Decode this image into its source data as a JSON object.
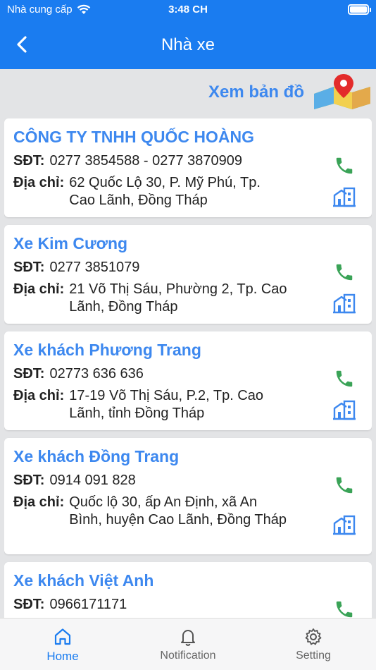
{
  "status_bar": {
    "carrier": "Nhà cung cấp",
    "time": "3:48 CH"
  },
  "header": {
    "title": "Nhà xe",
    "back_icon": "chevron-left-icon"
  },
  "map_link": {
    "label": "Xem bản đồ",
    "icon": "map-pin-icon"
  },
  "field_labels": {
    "phone": "SĐT:",
    "address": "Địa chỉ:"
  },
  "companies": [
    {
      "name": "CÔNG TY TNHH QUỐC HOÀNG",
      "phone": "0277 3854588 - 0277 3870909",
      "address": "62 Quốc Lộ 30, P. Mỹ Phú, Tp. Cao Lãnh, Đồng Tháp"
    },
    {
      "name": "Xe Kim Cương",
      "phone": "0277 3851079",
      "address": "21 Võ Thị Sáu, Phường 2, Tp. Cao Lãnh, Đồng Tháp"
    },
    {
      "name": "Xe khách Phương Trang",
      "phone": "02773 636 636",
      "address": "17-19 Võ Thị Sáu, P.2, Tp. Cao Lãnh, tỉnh Đồng Tháp"
    },
    {
      "name": "Xe khách Đồng Trang",
      "phone": "0914 091 828",
      "address": "Quốc lộ 30, ấp An Định, xã An Bình, huyện Cao Lãnh, Đồng Tháp"
    },
    {
      "name": "Xe khách Việt Anh",
      "phone": "0966171171",
      "address": ""
    }
  ],
  "tabs": [
    {
      "label": "Home",
      "icon": "home-icon",
      "active": true
    },
    {
      "label": "Notification",
      "icon": "bell-icon",
      "active": false
    },
    {
      "label": "Setting",
      "icon": "gear-icon",
      "active": false
    }
  ],
  "colors": {
    "primary": "#1a7cf0",
    "link": "#3d88ef",
    "phone": "#3aa357",
    "background": "#e3e4e6"
  }
}
